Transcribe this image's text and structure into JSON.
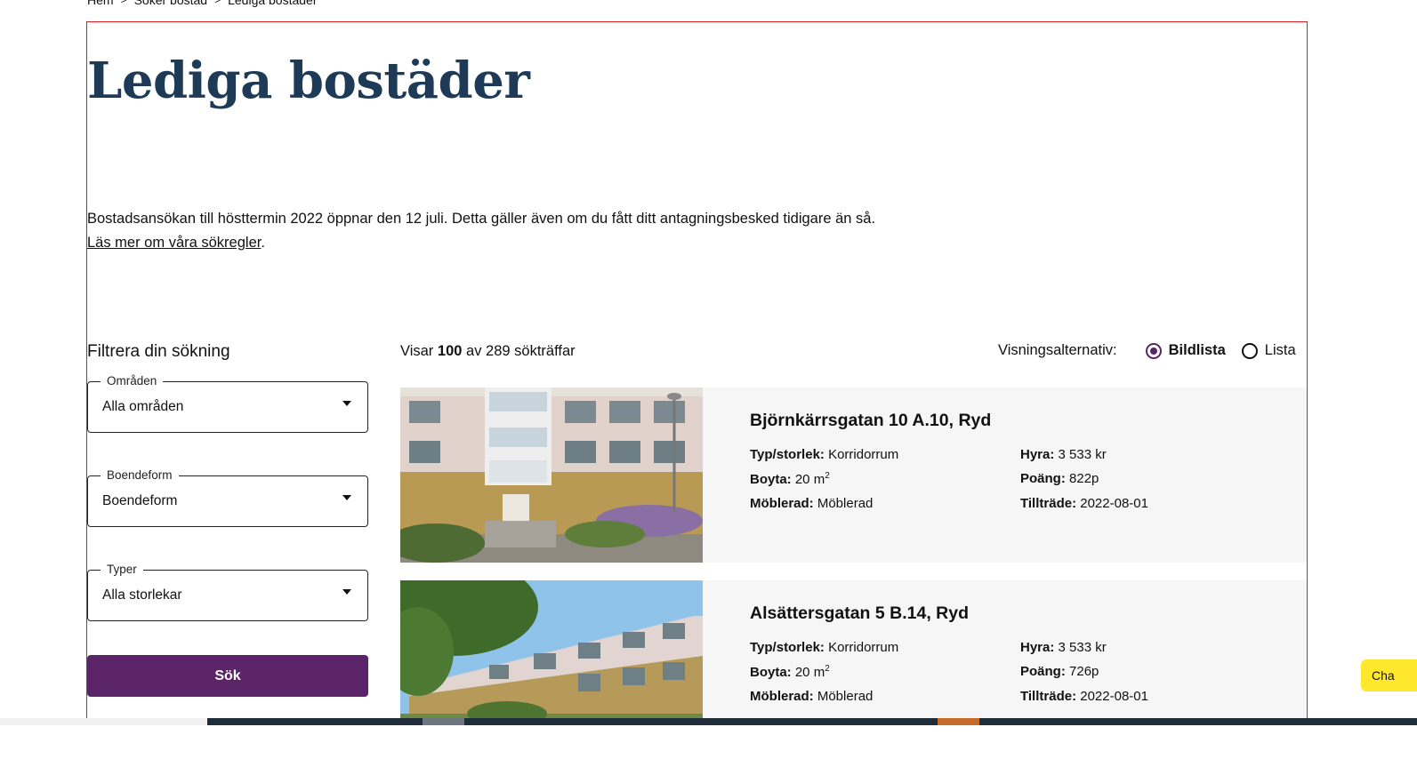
{
  "breadcrumb": {
    "items": [
      "Hem",
      "Söker bostad",
      "Lediga bostäder"
    ],
    "separator": ">"
  },
  "page": {
    "title": "Lediga bostäder",
    "intro_text": "Bostadsansökan till hösttermin 2022 öppnar den 12 juli. Detta gäller även om du fått ditt antagningsbesked tidigare än så.",
    "intro_link": "Läs mer om våra sökregler",
    "intro_link_suffix": "."
  },
  "filter": {
    "title": "Filtrera din sökning",
    "areas": {
      "label": "Områden",
      "value": "Alla områden"
    },
    "housing_type": {
      "label": "Boendeform",
      "value": "Boendeform"
    },
    "types": {
      "label": "Typer",
      "value": "Alla storlekar"
    },
    "search_label": "Sök"
  },
  "results": {
    "prefix": "Visar",
    "shown": "100",
    "middle": "av",
    "total": "289",
    "suffix": "sökträffar"
  },
  "view_options": {
    "label": "Visningsalternativ:",
    "image_list": "Bildlista",
    "list": "Lista",
    "selected": "Bildlista"
  },
  "listings": [
    {
      "title": "Björnkärrsgatan 10 A.10, Ryd",
      "type_label": "Typ/storlek:",
      "type_value": "Korridorrum",
      "area_label": "Boyta:",
      "area_value": "20 m",
      "area_unit_sup": "2",
      "furnished_label": "Möblerad:",
      "furnished_value": "Möblerad",
      "rent_label": "Hyra:",
      "rent_value": "3 533 kr",
      "points_label": "Poäng:",
      "points_value": "822p",
      "access_label": "Tillträde:",
      "access_value": "2022-08-01"
    },
    {
      "title": "Alsättersgatan 5 B.14, Ryd",
      "type_label": "Typ/storlek:",
      "type_value": "Korridorrum",
      "area_label": "Boyta:",
      "area_value": "20 m",
      "area_unit_sup": "2",
      "furnished_label": "Möblerad:",
      "furnished_value": "Möblerad",
      "rent_label": "Hyra:",
      "rent_value": "3 533 kr",
      "points_label": "Poäng:",
      "points_value": "726p",
      "access_label": "Tillträde:",
      "access_value": "2022-08-01"
    }
  ],
  "chat": {
    "label": "Cha"
  },
  "colors": {
    "title": "#1d3a57",
    "primary_button": "#5b2468",
    "card_background": "#f6f6f6",
    "chat_button": "#ffe82b",
    "frame_outline": "#e21b1b"
  }
}
